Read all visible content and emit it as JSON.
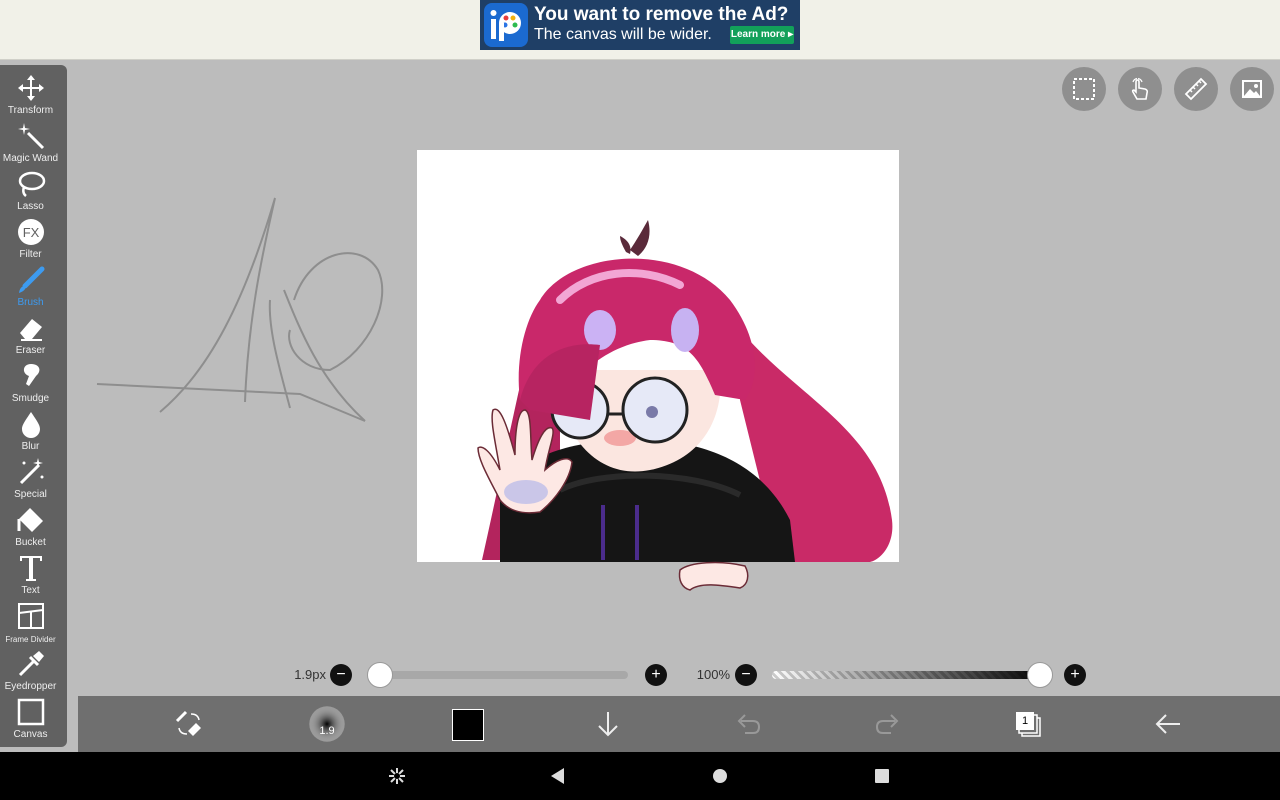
{
  "ad": {
    "headline": "You want to remove the Ad?",
    "subtext": "The canvas will be wider.",
    "button": "Learn more ▸",
    "logo_icon": "ibispaint-logo-icon"
  },
  "toolbar": {
    "active_color": "#3d9bf0",
    "items": [
      {
        "label": "Transform",
        "icon": "move-arrows-icon"
      },
      {
        "label": "Magic Wand",
        "icon": "magic-wand-icon"
      },
      {
        "label": "Lasso",
        "icon": "lasso-icon"
      },
      {
        "label": "Filter",
        "icon": "fx-filter-icon"
      },
      {
        "label": "Brush",
        "icon": "brush-icon",
        "active": true
      },
      {
        "label": "Eraser",
        "icon": "eraser-icon"
      },
      {
        "label": "Smudge",
        "icon": "smudge-icon"
      },
      {
        "label": "Blur",
        "icon": "blur-drop-icon"
      },
      {
        "label": "Special",
        "icon": "special-wand-icon"
      },
      {
        "label": "Bucket",
        "icon": "bucket-icon"
      },
      {
        "label": "Text",
        "icon": "text-icon"
      },
      {
        "label": "Frame Divider",
        "icon": "frame-divider-icon"
      },
      {
        "label": "Eyedropper",
        "icon": "eyedropper-icon"
      },
      {
        "label": "Canvas",
        "icon": "canvas-icon"
      }
    ]
  },
  "top_right_buttons": [
    {
      "name": "selection-button",
      "icon": "dashed-selection-icon"
    },
    {
      "name": "touch-button",
      "icon": "hand-touch-icon"
    },
    {
      "name": "ruler-button",
      "icon": "ruler-icon"
    },
    {
      "name": "reference-button",
      "icon": "image-icon"
    }
  ],
  "brush_size": {
    "label": "1.9px",
    "value_fraction": 0.0
  },
  "brush_opacity": {
    "label": "100%",
    "value_fraction": 1.0
  },
  "bottom_bar": {
    "brush_preview_label": "1.9",
    "current_color": "#000000",
    "layer_count": "1"
  },
  "nav": {
    "icons": [
      "screenshot-icon",
      "back-triangle-icon",
      "home-circle-icon",
      "recents-square-icon"
    ]
  }
}
